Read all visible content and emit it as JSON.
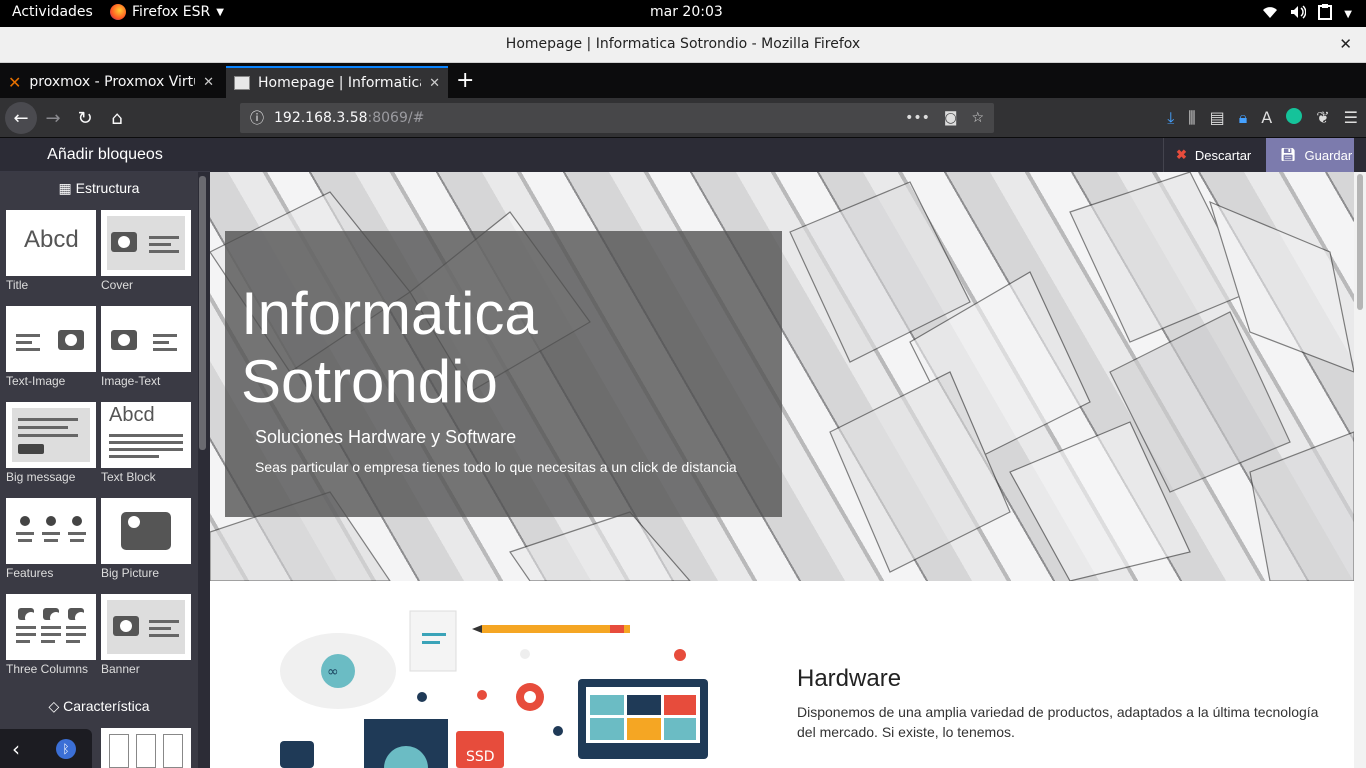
{
  "system": {
    "activities": "Actividades",
    "app_menu": "Firefox ESR",
    "clock": "mar 20:03"
  },
  "window": {
    "title": "Homepage | Informatica Sotrondio - Mozilla Firefox"
  },
  "tabs": [
    {
      "label": "proxmox - Proxmox Virtua"
    },
    {
      "label": "Homepage | Informatica S"
    }
  ],
  "urlbar": {
    "host": "192.168.3.58",
    "rest": ":8069/#"
  },
  "editor": {
    "sidebar_title": "Añadir bloqueos",
    "category_structure": "Estructura",
    "category_feature": "Característica",
    "blocks": [
      {
        "name": "Title"
      },
      {
        "name": "Cover"
      },
      {
        "name": "Text-Image"
      },
      {
        "name": "Image-Text"
      },
      {
        "name": "Big message"
      },
      {
        "name": "Text Block"
      },
      {
        "name": "Features"
      },
      {
        "name": "Big Picture"
      },
      {
        "name": "Three Columns"
      },
      {
        "name": "Banner"
      }
    ],
    "thumb_text": "Abcd",
    "discard_label": "Descartar",
    "save_label": "Guardar"
  },
  "hero": {
    "title": "Informatica Sotrondio",
    "subtitle": "Soluciones Hardware y Software",
    "description": "Seas particular o empresa tienes todo lo que necesitas a un click de distancia"
  },
  "section": {
    "title": "Hardware",
    "text": "Disponemos de una amplia variedad de productos, adaptados a la última tecnología del mercado. Si existe, lo tenemos.",
    "ssd_label": "SSD"
  },
  "colors": {
    "accent": "#0a84ff",
    "save_button": "#7c7bad",
    "discard_icon": "#e74c3c"
  }
}
